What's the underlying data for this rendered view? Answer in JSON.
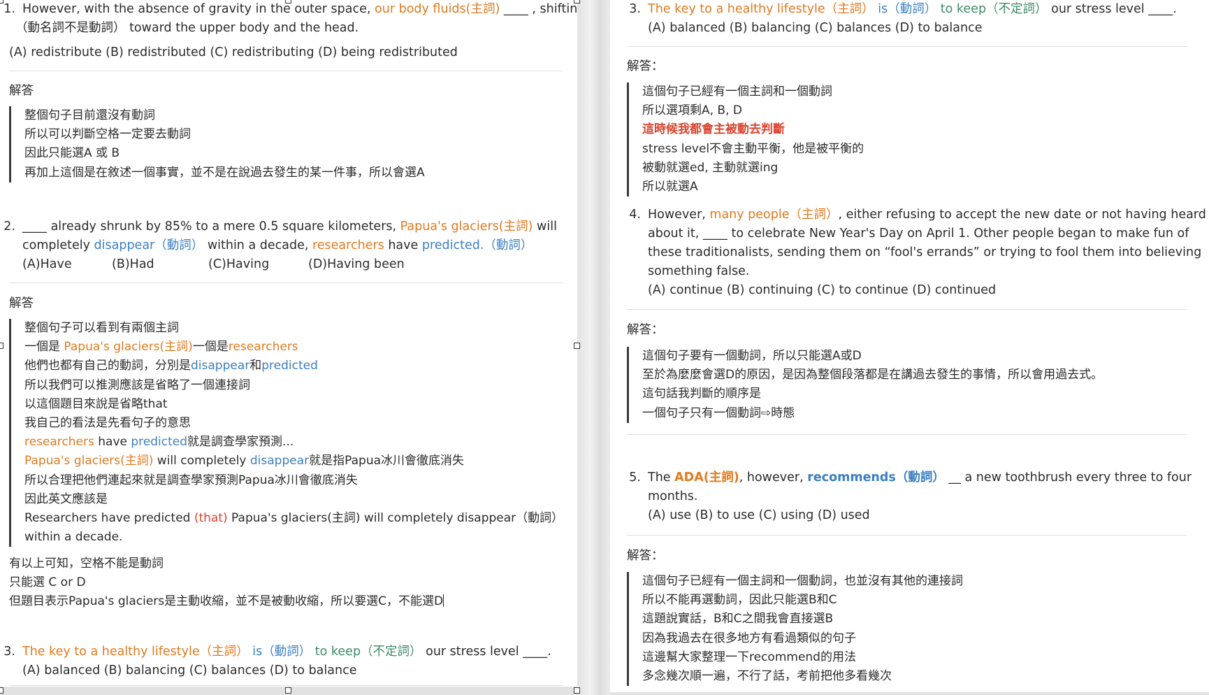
{
  "left": {
    "q1": {
      "num": "1.",
      "t1": "However, with the absence of gravity in the outer space, ",
      "t2": "our body fluids(主詞)",
      "t3": " ____ , shifting",
      "t4": "（動名詞不是動詞）",
      "t5": " toward the upper body and the head.",
      "options": "(A) redistribute (B) redistributed (C) redistributing (D) being redistributed"
    },
    "a1": {
      "label": "解答",
      "lines": [
        "整個句子目前還沒有動詞",
        "所以可以判斷空格一定要去動詞",
        "因此只能選A 或 B",
        "再加上這個是在敘述一個事實，並不是在說過去發生的某一件事，所以會選A"
      ]
    },
    "q2": {
      "num": "2.",
      "t1": "____ already shrunk by 85% to a mere 0.5 square kilometers, ",
      "t2": "Papua's glaciers(主詞)",
      "t3": " will",
      "t4": "completely ",
      "t5": "disappear（動詞）",
      "t6": " within a decade, ",
      "t7": "researchers",
      "t8": " have ",
      "t9": "predicted.（動詞）",
      "opt": [
        "(A)Have",
        "(B)Had",
        "(C)Having",
        "(D)Having been"
      ]
    },
    "a2": {
      "label": "解答",
      "l1": "整個句子可以看到有兩個主詞",
      "l2a": "一個是 ",
      "l2b": "Papua's glaciers(主詞)",
      "l2c": "一個是",
      "l2d": "researchers",
      "l3a": "他們也都有自己的動詞，分別是",
      "l3b": "disappear",
      "l3c": "和",
      "l3d": "predicted",
      "l4": "所以我們可以推測應該是省略了一個連接詞",
      "l5": "以這個題目來說是省略that",
      "l6": "我自己的看法是先看句子的意思",
      "l7a": "researchers",
      "l7b": " have ",
      "l7c": "predicted",
      "l7d": "就是調查學家預測...",
      "l8a": "Papua's glaciers(主詞)",
      "l8b": " will completely ",
      "l8c": "disappear",
      "l8d": "就是指Papua冰川會徹底消失",
      "l9": "所以合理把他們連起來就是調查學家預測Papua冰川會徹底消失",
      "l10": "因此英文應該是",
      "l11a": "Researchers have predicted ",
      "l11b": "(that)",
      "l11c": " Papua's glaciers(主詞) will completely disappear（動詞）",
      "l12": "within a decade.",
      "p1": "有以上可知，空格不能是動詞",
      "p2": "只能選 C or D",
      "p3": "但題目表示Papua's glaciers是主動收縮，並不是被動收縮，所以要選C，不能選D"
    },
    "q3": {
      "num": "3.",
      "t1": "The key to a healthy lifestyle（主詞）",
      "t2": " is（動詞）",
      "t3": " to keep（不定詞）",
      "t4": " our stress level ____.",
      "options": "(A) balanced (B) balancing (C) balances (D) to balance"
    }
  },
  "right": {
    "q3": {
      "num": "3.",
      "t1": "The key to a healthy lifestyle（主詞）",
      "t2": " is（動詞）",
      "t3": " to keep（不定詞）",
      "t4": " our stress level ____.",
      "options": "(A) balanced (B) balancing (C) balances (D) to balance"
    },
    "a3": {
      "label": "解答：",
      "l1": "這個句子已經有一個主詞和一個動詞",
      "l2": "所以選項剩A, B, D",
      "l3": "這時候我都會主被動去判斷",
      "l4": "stress level不會主動平衡，他是被平衡的",
      "l5": "被動就選ed, 主動就選ing",
      "l6": "所以就選A"
    },
    "q4": {
      "num": "4.",
      "t1": "However, ",
      "t2": "many people（主詞）",
      "t3": ", either refusing to accept the new date or not having heard",
      "l2": "about it, ____ to celebrate New Year's Day on April 1. Other people began to make fun of",
      "l3": "these traditionalists, sending them on “fool's errands” or trying to fool them into believing",
      "l4": "something false.",
      "options": "(A) continue (B) continuing (C) to continue (D) continued"
    },
    "a4": {
      "label": "解答：",
      "l1": "這個句子要有一個動詞，所以只能選A或D",
      "l2": "至於為麼麼會選D的原因，是因為整個段落都是在講過去發生的事情，所以會用過去式。",
      "l3": "這句話我判斷的順序是",
      "l4": "一個句子只有一個動詞⇨時態"
    },
    "q5": {
      "num": "5.",
      "t1": "The ",
      "t2": "ADA(主詞)",
      "t3": ", however, ",
      "t4": "recommends（動詞）",
      "t5": " __ a new toothbrush every three to four",
      "l2": "months.",
      "options": "(A) use (B) to use (C) using (D) used"
    },
    "a5": {
      "label": "解答：",
      "l1": "這個句子已經有一個主詞和一個動詞，也並沒有其他的連接詞",
      "l2": "所以不能再選動詞，因此只能選B和C",
      "l3": "這題說實話，B和C之間我會直接選B",
      "l4": "因為我過去在很多地方有看過類似的句子",
      "l5": "這邊幫大家整理一下recommend的用法",
      "l6": "多念幾次順一遍，不行了話，考前把他多看幾次"
    }
  }
}
